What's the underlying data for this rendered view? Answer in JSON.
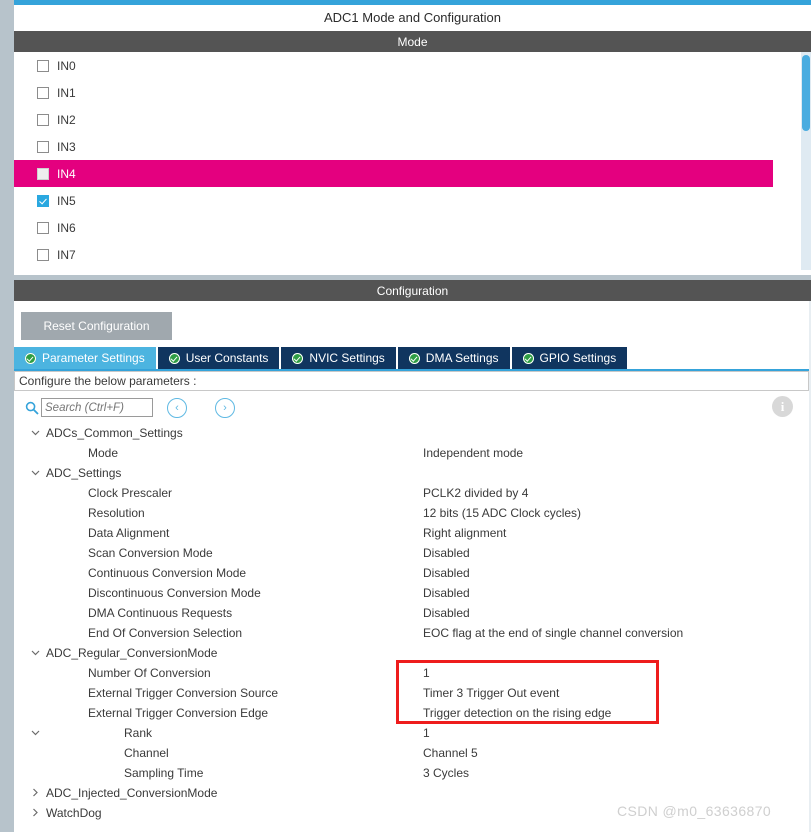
{
  "window": {
    "title": "ADC1 Mode and Configuration"
  },
  "mode_section": {
    "header": "Mode",
    "channels": [
      {
        "label": "IN0",
        "checked": false,
        "highlighted": false
      },
      {
        "label": "IN1",
        "checked": false,
        "highlighted": false
      },
      {
        "label": "IN2",
        "checked": false,
        "highlighted": false
      },
      {
        "label": "IN3",
        "checked": false,
        "highlighted": false
      },
      {
        "label": "IN4",
        "checked": false,
        "highlighted": true
      },
      {
        "label": "IN5",
        "checked": true,
        "highlighted": false
      },
      {
        "label": "IN6",
        "checked": false,
        "highlighted": false
      },
      {
        "label": "IN7",
        "checked": false,
        "highlighted": false
      }
    ],
    "highlight_color": "#e4007f",
    "checked_color": "#2aa8e0"
  },
  "configuration": {
    "header": "Configuration",
    "reset_button": "Reset Configuration",
    "tabs": [
      {
        "label": "Parameter Settings",
        "active": true
      },
      {
        "label": "User Constants",
        "active": false
      },
      {
        "label": "NVIC Settings",
        "active": false
      },
      {
        "label": "DMA Settings",
        "active": false
      },
      {
        "label": "GPIO Settings",
        "active": false
      }
    ],
    "hint": "Configure the below parameters :",
    "search": {
      "placeholder": "Search (Ctrl+F)",
      "value": "",
      "prev_label": "‹",
      "next_label": "›"
    },
    "info_label": "i"
  },
  "tree": {
    "chevron_expanded": "⌄",
    "chevron_collapsed": "›",
    "rows": [
      {
        "label": "ADCs_Common_Settings",
        "value": "",
        "indent": "lvl1",
        "expander": "expanded"
      },
      {
        "label": "Mode",
        "value": "Independent mode",
        "indent": "lvl2",
        "expander": "none"
      },
      {
        "label": "ADC_Settings",
        "value": "",
        "indent": "lvl1",
        "expander": "expanded"
      },
      {
        "label": "Clock Prescaler",
        "value": "PCLK2 divided by 4",
        "indent": "lvl2",
        "expander": "none"
      },
      {
        "label": "Resolution",
        "value": "12 bits (15 ADC Clock cycles)",
        "indent": "lvl2",
        "expander": "none"
      },
      {
        "label": "Data Alignment",
        "value": "Right alignment",
        "indent": "lvl2",
        "expander": "none"
      },
      {
        "label": "Scan Conversion Mode",
        "value": "Disabled",
        "indent": "lvl2",
        "expander": "none"
      },
      {
        "label": "Continuous Conversion Mode",
        "value": "Disabled",
        "indent": "lvl2",
        "expander": "none"
      },
      {
        "label": "Discontinuous Conversion Mode",
        "value": "Disabled",
        "indent": "lvl2",
        "expander": "none"
      },
      {
        "label": "DMA Continuous Requests",
        "value": "Disabled",
        "indent": "lvl2",
        "expander": "none"
      },
      {
        "label": "End Of Conversion Selection",
        "value": "EOC flag at the end of single channel conversion",
        "indent": "lvl2",
        "expander": "none"
      },
      {
        "label": "ADC_Regular_ConversionMode",
        "value": "",
        "indent": "lvl1",
        "expander": "expanded"
      },
      {
        "label": "Number Of Conversion",
        "value": "1",
        "indent": "lvl2",
        "expander": "none"
      },
      {
        "label": "External Trigger Conversion Source",
        "value": "Timer 3 Trigger Out event",
        "indent": "lvl2",
        "expander": "none"
      },
      {
        "label": "External Trigger Conversion Edge",
        "value": "Trigger detection on the rising edge",
        "indent": "lvl2",
        "expander": "none"
      },
      {
        "label": "Rank",
        "value": "1",
        "indent": "lvl3",
        "expander": "expanded"
      },
      {
        "label": "Channel",
        "value": "Channel 5",
        "indent": "lvl3",
        "expander": "none"
      },
      {
        "label": "Sampling Time",
        "value": "3 Cycles",
        "indent": "lvl3",
        "expander": "none"
      },
      {
        "label": "ADC_Injected_ConversionMode",
        "value": "",
        "indent": "lvl1",
        "expander": "collapsed"
      },
      {
        "label": "WatchDog",
        "value": "",
        "indent": "lvl1",
        "expander": "collapsed"
      }
    ]
  },
  "annotation": {
    "color": "#ee1c1c"
  },
  "watermark": {
    "text": "CSDN @m0_63636870"
  }
}
